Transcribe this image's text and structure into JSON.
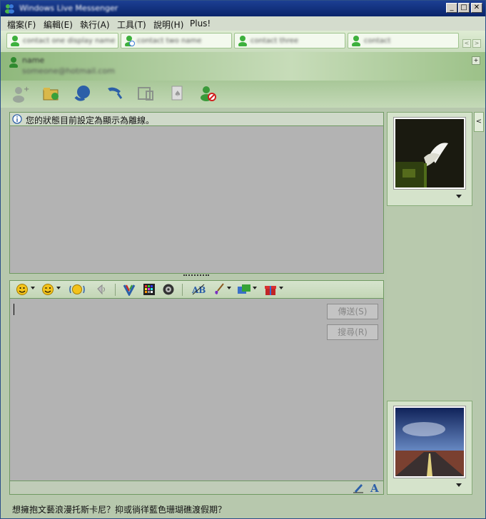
{
  "window": {
    "title": "Windows Live Messenger",
    "controls": {
      "minimize": "_",
      "maximize": "□",
      "close": "✕"
    }
  },
  "menu": [
    {
      "label": "檔案(F)"
    },
    {
      "label": "編輯(E)"
    },
    {
      "label": "執行(A)"
    },
    {
      "label": "工具(T)"
    },
    {
      "label": "說明(H)"
    },
    {
      "label": "Plus!"
    }
  ],
  "tabs": [
    {
      "label": "contact one display name"
    },
    {
      "label": "contact two name"
    },
    {
      "label": "contact three"
    },
    {
      "label": "contact"
    }
  ],
  "tab_nav": {
    "prev": "<",
    "next": ">"
  },
  "contact": {
    "name": "name",
    "email": "someone@hotmail.com"
  },
  "status_message": "您的狀態目前設定為顯示為離線。",
  "buttons": {
    "send": "傳送(S)",
    "search": "搜尋(R)"
  },
  "bottom_ad": "想擁抱文藝浪漫托斯卡尼？抑或徜徉藍色珊瑚礁渡假期？",
  "colors": {
    "accent": "#7aa86a",
    "titlebar": "#0a246a"
  },
  "icons": {
    "toolbar": [
      "invite-contact-icon",
      "send-files-icon",
      "video-call-icon",
      "phone-call-icon",
      "activities-icon",
      "games-icon",
      "block-contact-icon"
    ],
    "format": [
      "emoticon-icon",
      "wink-icon",
      "nudge-icon",
      "voice-clip-icon",
      "handwriting-icon",
      "background-icon",
      "sound-icon",
      "font-icon",
      "color-icon",
      "share-icon",
      "gift-icon"
    ]
  }
}
